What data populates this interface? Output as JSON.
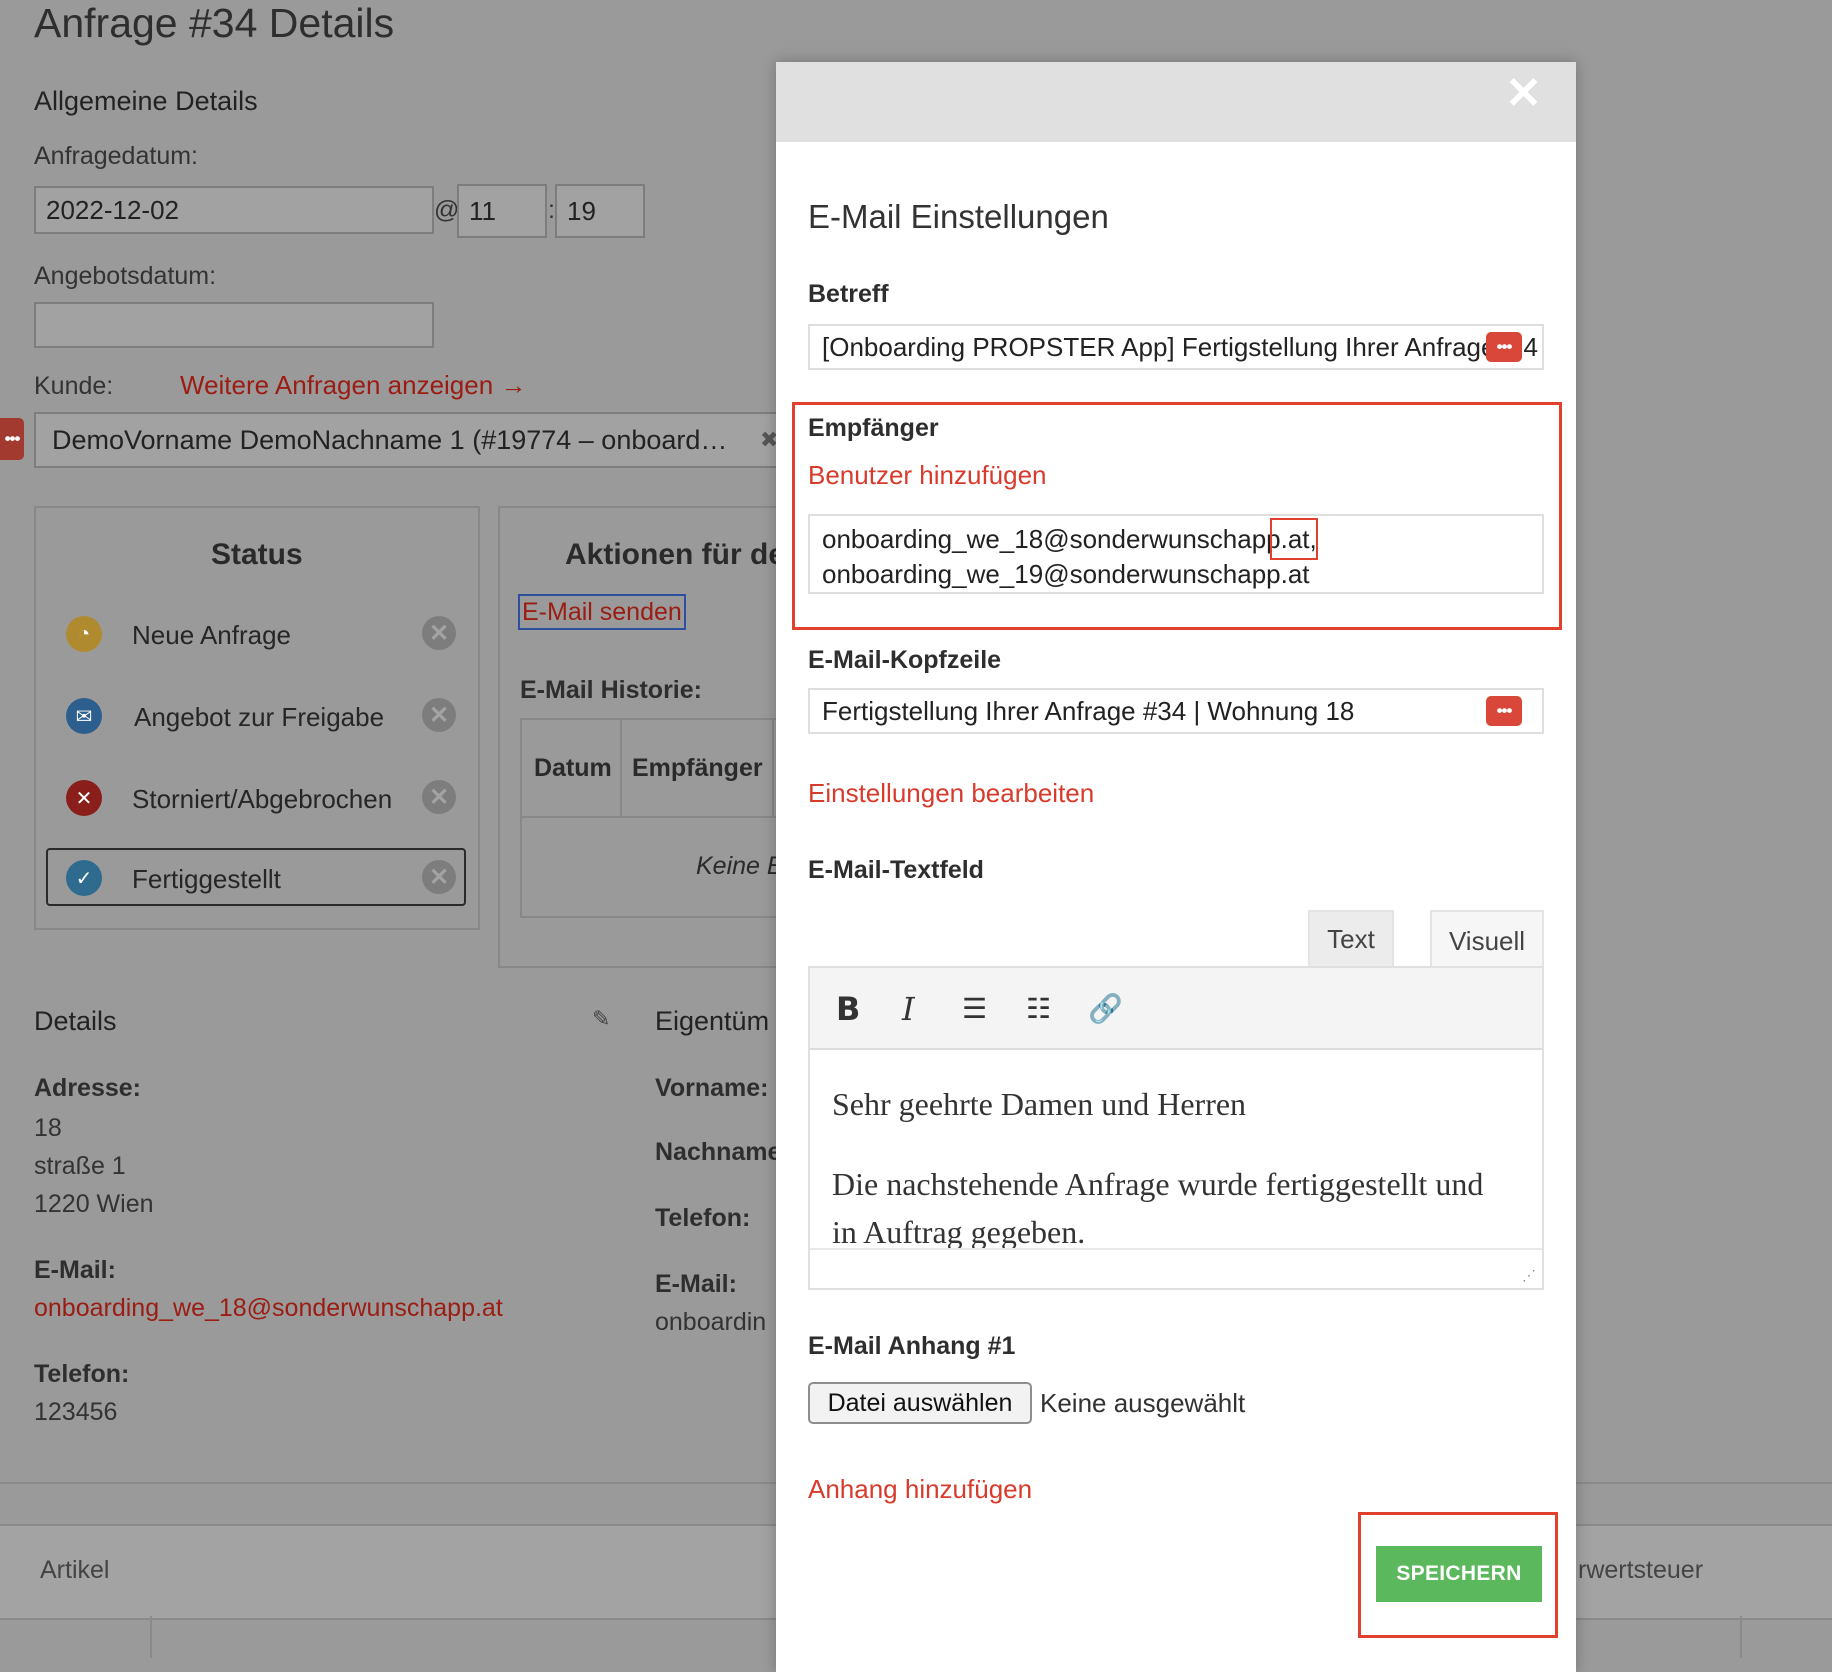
{
  "page": {
    "title": "Anfrage #34 Details",
    "general_heading": "Allgemeine Details",
    "request_date_label": "Anfragedatum:",
    "request_date": "2022-12-02",
    "at_sign": "@",
    "hour": "11",
    "time_sep": ":",
    "minute": "19",
    "offer_date_label": "Angebotsdatum:",
    "offer_date": "",
    "customer_label": "Kunde:",
    "more_requests_link": "Weitere Anfragen anzeigen →",
    "customer_value": "DemoVorname DemoNachname 1 (#19774 – onboard…",
    "status_heading": "Status",
    "status_items": [
      {
        "label": "Neue Anfrage",
        "color": "#b08a2e"
      },
      {
        "label": "Angebot zur Freigabe",
        "color": "#2d5f8e"
      },
      {
        "label": "Storniert/Abgebrochen",
        "color": "#8a1e1b"
      },
      {
        "label": "Fertiggestellt",
        "color": "#2e6b8e"
      }
    ],
    "actions_heading": "Aktionen für de",
    "send_email_link": "E-Mail senden",
    "email_history_label": "E-Mail Historie:",
    "history_cols": [
      "Datum",
      "Empfänger"
    ],
    "history_empty": "Keine E",
    "details_heading": "Details",
    "address_label": "Adresse:",
    "address_lines": [
      "18",
      "straße 1",
      "1220 Wien"
    ],
    "email_label": "E-Mail:",
    "email_value": "onboarding_we_18@sonderwunschapp.at",
    "phone_label": "Telefon:",
    "phone_value": "123456",
    "owner_heading": "Eigentüm",
    "owner_firstname_label": "Vorname:",
    "owner_lastname_label": "Nachname",
    "owner_phone_label": "Telefon:",
    "owner_email_label": "E-Mail:",
    "owner_email_value": "onboardin",
    "articles_label": "Artikel",
    "vat_label": "rwertsteuer"
  },
  "modal": {
    "heading": "E-Mail Einstellungen",
    "subject_label": "Betreff",
    "subject_value": "[Onboarding PROPSTER App] Fertigstellung Ihrer Anfrage",
    "subject_tail": "4",
    "recipients_label": "Empfänger",
    "add_user_link": "Benutzer hinzufügen",
    "recipients": [
      "onboarding_we_18@sonderwunschapp.at,",
      "onboarding_we_19@sonderwunschapp.at"
    ],
    "header_label": "E-Mail-Kopfzeile",
    "header_value": "Fertigstellung Ihrer Anfrage #34 | Wohnung 18",
    "edit_settings_link": "Einstellungen bearbeiten",
    "body_label": "E-Mail-Textfeld",
    "tabs": [
      "Text",
      "Visuell"
    ],
    "body_paragraphs": [
      "Sehr geehrte Damen und Herren",
      "Die nachstehende Anfrage wurde fertiggestellt und in Auftrag gegeben."
    ],
    "attachment_label": "E-Mail Anhang #1",
    "choose_file_button": "Datei auswählen",
    "no_file_text": "Keine ausgewählt",
    "add_attachment_link": "Anhang hinzufügen",
    "save_button": "SPEICHERN",
    "chip_glyph": "•••",
    "close_glyph": "✕"
  },
  "colors": {
    "accent_red": "#d83a2b",
    "save_green": "#5cb85c",
    "highlight_red": "#e0402c"
  }
}
